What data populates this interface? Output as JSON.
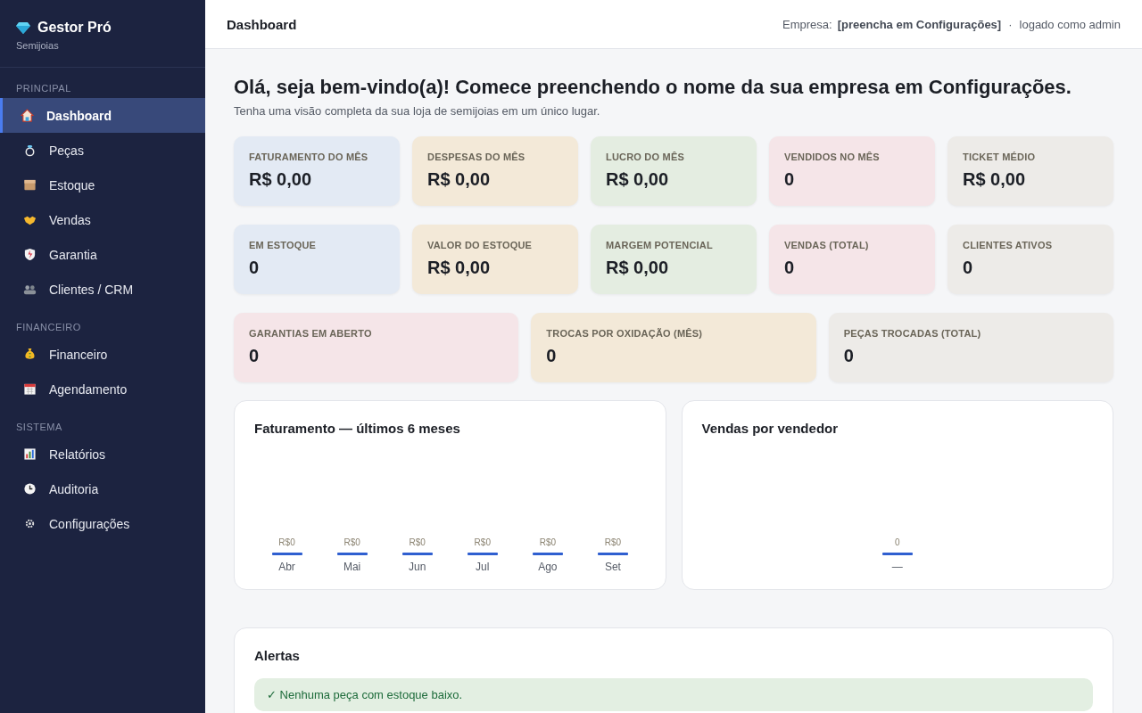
{
  "brand": {
    "name": "Gestor Pró",
    "subtitle": "Semijoias"
  },
  "sidebar": {
    "sections": [
      {
        "label": "PRINCIPAL",
        "items": [
          {
            "label": "Dashboard",
            "selected": true
          },
          {
            "label": "Peças",
            "selected": false
          },
          {
            "label": "Estoque",
            "selected": false
          },
          {
            "label": "Vendas",
            "selected": false
          },
          {
            "label": "Garantia",
            "selected": false
          },
          {
            "label": "Clientes / CRM",
            "selected": false
          }
        ]
      },
      {
        "label": "FINANCEIRO",
        "items": [
          {
            "label": "Financeiro",
            "selected": false
          },
          {
            "label": "Agendamento",
            "selected": false
          }
        ]
      },
      {
        "label": "SISTEMA",
        "items": [
          {
            "label": "Relatórios",
            "selected": false
          },
          {
            "label": "Auditoria",
            "selected": false
          },
          {
            "label": "Configurações",
            "selected": false
          }
        ]
      }
    ]
  },
  "header": {
    "title": "Dashboard",
    "company_label": "Empresa:",
    "company_value": "[preencha em Configurações]",
    "separator": "·",
    "user": "logado como admin"
  },
  "welcome": {
    "title": "Olá, seja bem-vindo(a)! Comece preenchendo o nome da sua empresa em Configurações.",
    "subtitle": "Tenha uma visão completa da sua loja de semijoias em um único lugar."
  },
  "stat_rows": [
    [
      {
        "label": "FATURAMENTO DO MÊS",
        "value": "R$ 0,00",
        "color": "#e3eaf4"
      },
      {
        "label": "DESPESAS DO MÊS",
        "value": "R$ 0,00",
        "color": "#f3e9d8"
      },
      {
        "label": "LUCRO DO MÊS",
        "value": "R$ 0,00",
        "color": "#e4ede1"
      },
      {
        "label": "VENDIDOS NO MÊS",
        "value": "0",
        "color": "#f5e5e8"
      },
      {
        "label": "TICKET MÉDIO",
        "value": "R$ 0,00",
        "color": "#edebe8"
      }
    ],
    [
      {
        "label": "EM ESTOQUE",
        "value": "0",
        "color": "#e3eaf4"
      },
      {
        "label": "VALOR DO ESTOQUE",
        "value": "R$ 0,00",
        "color": "#f3e9d8"
      },
      {
        "label": "MARGEM POTENCIAL",
        "value": "R$ 0,00",
        "color": "#e4ede1"
      },
      {
        "label": "VENDAS (TOTAL)",
        "value": "0",
        "color": "#f5e5e8"
      },
      {
        "label": "CLIENTES ATIVOS",
        "value": "0",
        "color": "#edebe8"
      }
    ],
    [
      {
        "label": "GARANTIAS EM ABERTO",
        "value": "0",
        "color": "#f5e5e8"
      },
      {
        "label": "TROCAS POR OXIDAÇÃO (MÊS)",
        "value": "0",
        "color": "#f3e9d8"
      },
      {
        "label": "PEÇAS TROCADAS (TOTAL)",
        "value": "0",
        "color": "#edebe8"
      }
    ]
  ],
  "charts": [
    {
      "title": "Faturamento — últimos 6 meses",
      "columns": [
        {
          "value": "R$0",
          "label": "Abr"
        },
        {
          "value": "R$0",
          "label": "Mai"
        },
        {
          "value": "R$0",
          "label": "Jun"
        },
        {
          "value": "R$0",
          "label": "Jul"
        },
        {
          "value": "R$0",
          "label": "Ago"
        },
        {
          "value": "R$0",
          "label": "Set"
        }
      ]
    },
    {
      "title": "Vendas por vendedor",
      "columns": [
        {
          "value": "0",
          "label": "—"
        }
      ]
    }
  ],
  "alerts": {
    "title": "Alertas",
    "items": [
      {
        "text": "✓ Nenhuma peça com estoque baixo."
      }
    ]
  }
}
